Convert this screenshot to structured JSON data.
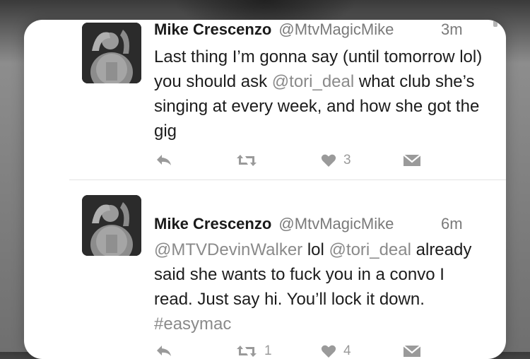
{
  "tweets": [
    {
      "name": "Mike Crescenzo",
      "handle": "@MtvMagicMike",
      "time": "3m",
      "text": {
        "p1": "Last thing I’m gonna say (until tomorrow lol) you should ask ",
        "mention1": "@tori_deal",
        "p2": " what club she’s singing at every week, and how she got the gig"
      },
      "actions": {
        "retweets": "",
        "likes": "3"
      }
    },
    {
      "name": "Mike Crescenzo",
      "handle": "@MtvMagicMike",
      "time": "6m",
      "text": {
        "mention1": "@MTVDevinWalker",
        "p1": " lol ",
        "mention2": "@tori_deal",
        "p2": " already said she wants to fuck you in a convo I read. Just say hi. You’ll lock it down. ",
        "hashtag": "#easymac"
      },
      "actions": {
        "retweets": "1",
        "likes": "4"
      }
    }
  ],
  "icons": {
    "avatar": "profile-photo",
    "reply": "reply-icon",
    "retweet": "retweet-icon",
    "like": "heart-icon",
    "dm": "direct-message-icon"
  },
  "colors": {
    "card": "#ffffff",
    "text": "#1c1c1c",
    "secondary": "#7a7a7a",
    "icon": "#9a9a9a",
    "divider": "#e2e2e2"
  }
}
